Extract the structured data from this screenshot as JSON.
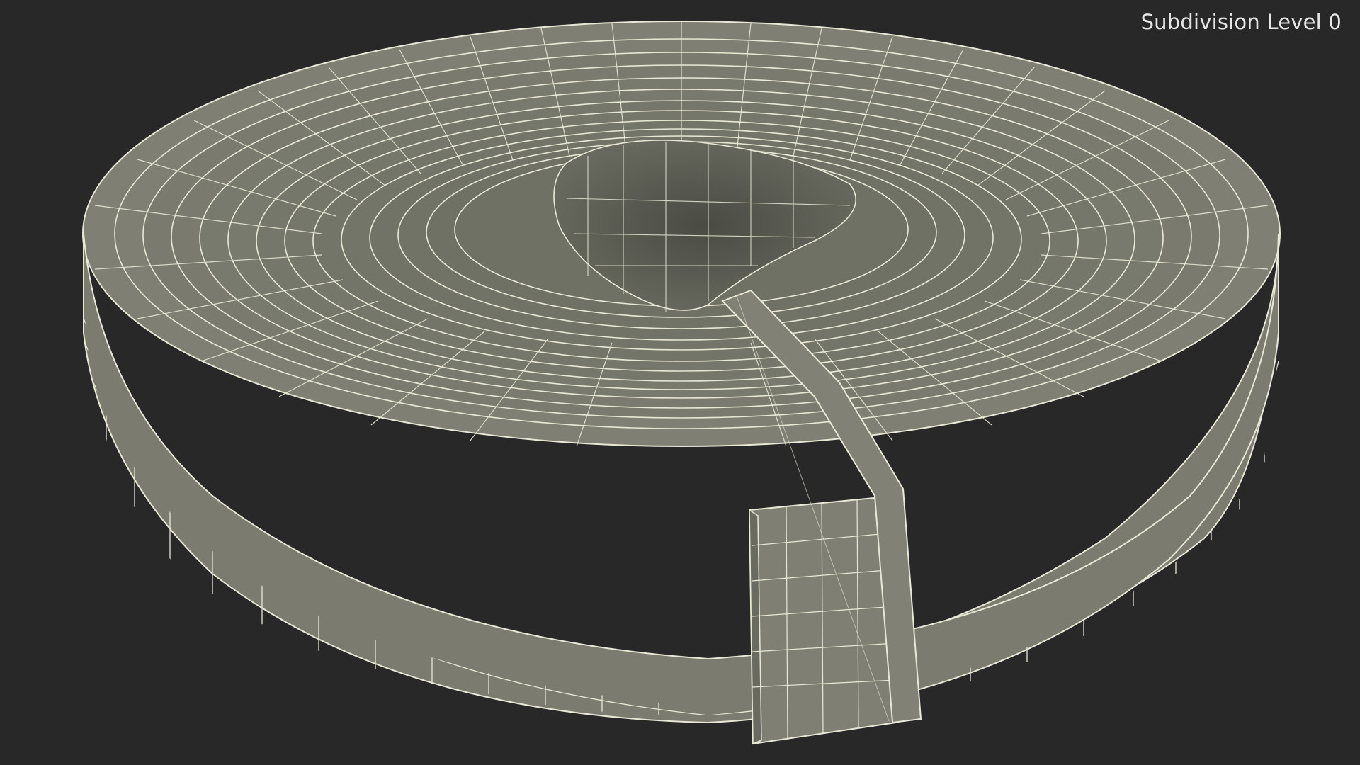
{
  "viewport": {
    "overlay_label": "Subdivision Level 0",
    "background_color": "#282828"
  },
  "model": {
    "subject": "coiled flat hose wireframe",
    "surface_color": "#7b7c6f",
    "wire_color": "#e9e8d6"
  }
}
